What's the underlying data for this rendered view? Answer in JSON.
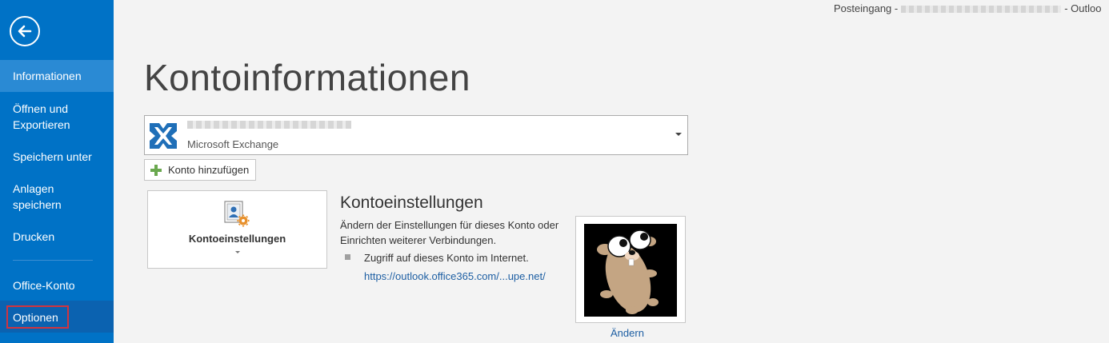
{
  "titlebar": {
    "left": "Posteingang -",
    "right": "- Outloo"
  },
  "sidebar": {
    "items": [
      {
        "label": "Informationen"
      },
      {
        "label": "Öffnen und Exportieren"
      },
      {
        "label": "Speichern unter"
      },
      {
        "label": "Anlagen speichern"
      },
      {
        "label": "Drucken"
      },
      {
        "label": "Office-Konto"
      },
      {
        "label": "Optionen"
      }
    ]
  },
  "main": {
    "title": "Kontoinformationen",
    "account": {
      "type": "Microsoft Exchange"
    },
    "add_account_label": "Konto hinzufügen",
    "settings_button_label": "Kontoeinstellungen",
    "section_title": "Kontoeinstellungen",
    "section_desc": "Ändern der Einstellungen für dieses Konto oder Einrichten weiterer Verbindungen.",
    "bullet_text": "Zugriff auf dieses Konto im Internet.",
    "link_text": "https://outlook.office365.com/...upe.net/",
    "change_label": "Ändern"
  },
  "colors": {
    "accent": "#0072c6",
    "highlight_border": "#d1343e",
    "link": "#1e5fa3"
  }
}
